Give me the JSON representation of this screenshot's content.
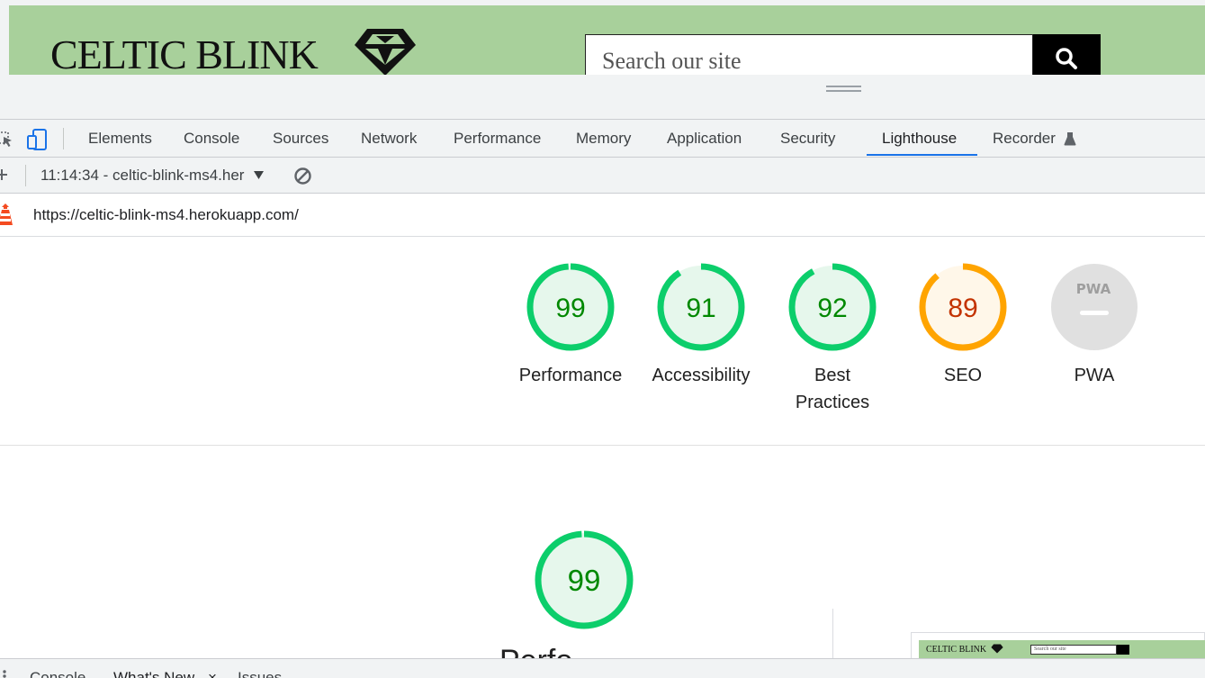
{
  "site": {
    "logo_text": "CELTIC BLINK",
    "search_placeholder": "Search our site"
  },
  "devtools": {
    "tabs": [
      "Elements",
      "Console",
      "Sources",
      "Network",
      "Performance",
      "Memory",
      "Application",
      "Security",
      "Lighthouse",
      "Recorder"
    ],
    "active_tab": "Lighthouse"
  },
  "lighthouse": {
    "report_selector": "11:14:34 - celtic-blink-ms4.her",
    "url": "https://celtic-blink-ms4.herokuapp.com/",
    "categories": [
      {
        "label": "Performance",
        "score": "99",
        "value": 0.99,
        "status": "pass"
      },
      {
        "label": "Accessibility",
        "score": "91",
        "value": 0.91,
        "status": "pass"
      },
      {
        "label": "Best Practices",
        "score": "92",
        "value": 0.92,
        "status": "pass"
      },
      {
        "label": "SEO",
        "score": "89",
        "value": 0.89,
        "status": "average"
      },
      {
        "label": "PWA",
        "score": "PWA",
        "status": "na"
      }
    ],
    "performance": {
      "score": "99",
      "value": 0.99,
      "title": "Perfo"
    },
    "thumbnail": {
      "logo_text": "CELTIC BLINK",
      "search_placeholder": "Search our site"
    }
  },
  "drawer": {
    "tabs": [
      "Console",
      "What's New",
      "Issues"
    ],
    "close_glyph": "×"
  },
  "colors": {
    "pass": "#0cce6b",
    "pass_text": "#008800",
    "pass_fill": "#e6f7ec",
    "average": "#ffa400",
    "average_text": "#c33300",
    "average_fill": "#fff7e9",
    "na_fill": "#e0e0e0",
    "site_green": "#a8d09b",
    "accent": "#1a73e8"
  }
}
